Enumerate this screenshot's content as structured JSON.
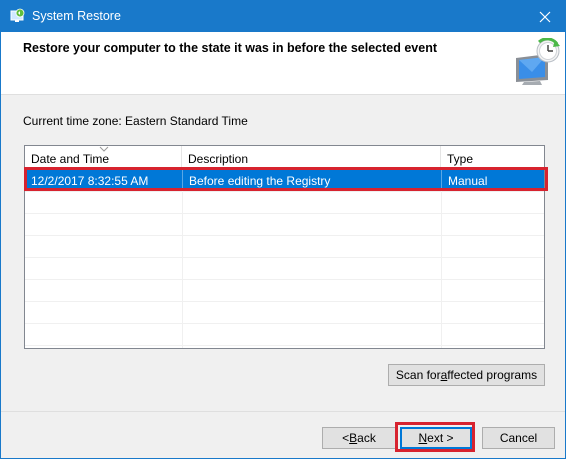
{
  "window": {
    "title": "System Restore",
    "accent_color": "#1979ca"
  },
  "header": {
    "heading": "Restore your computer to the state it was in before the selected event",
    "icon": "system-restore-monitor-icon"
  },
  "timezone": {
    "text": "Current time zone: Eastern Standard Time"
  },
  "restore_points": {
    "columns": [
      "Date and Time",
      "Description",
      "Type"
    ],
    "rows": [
      {
        "date_time": "12/2/2017 8:32:55 AM",
        "description": "Before editing the Registry",
        "type": "Manual",
        "selected": true
      }
    ],
    "selected_color": "#0078d7"
  },
  "buttons": {
    "scan_prefix": "Scan for ",
    "scan_accel": "a",
    "scan_suffix": "ffected programs",
    "back_prefix": "< ",
    "back_accel": "B",
    "back_suffix": "ack",
    "next_accel": "N",
    "next_suffix": "ext >",
    "cancel": "Cancel"
  },
  "annotation_color": "#d7232f"
}
